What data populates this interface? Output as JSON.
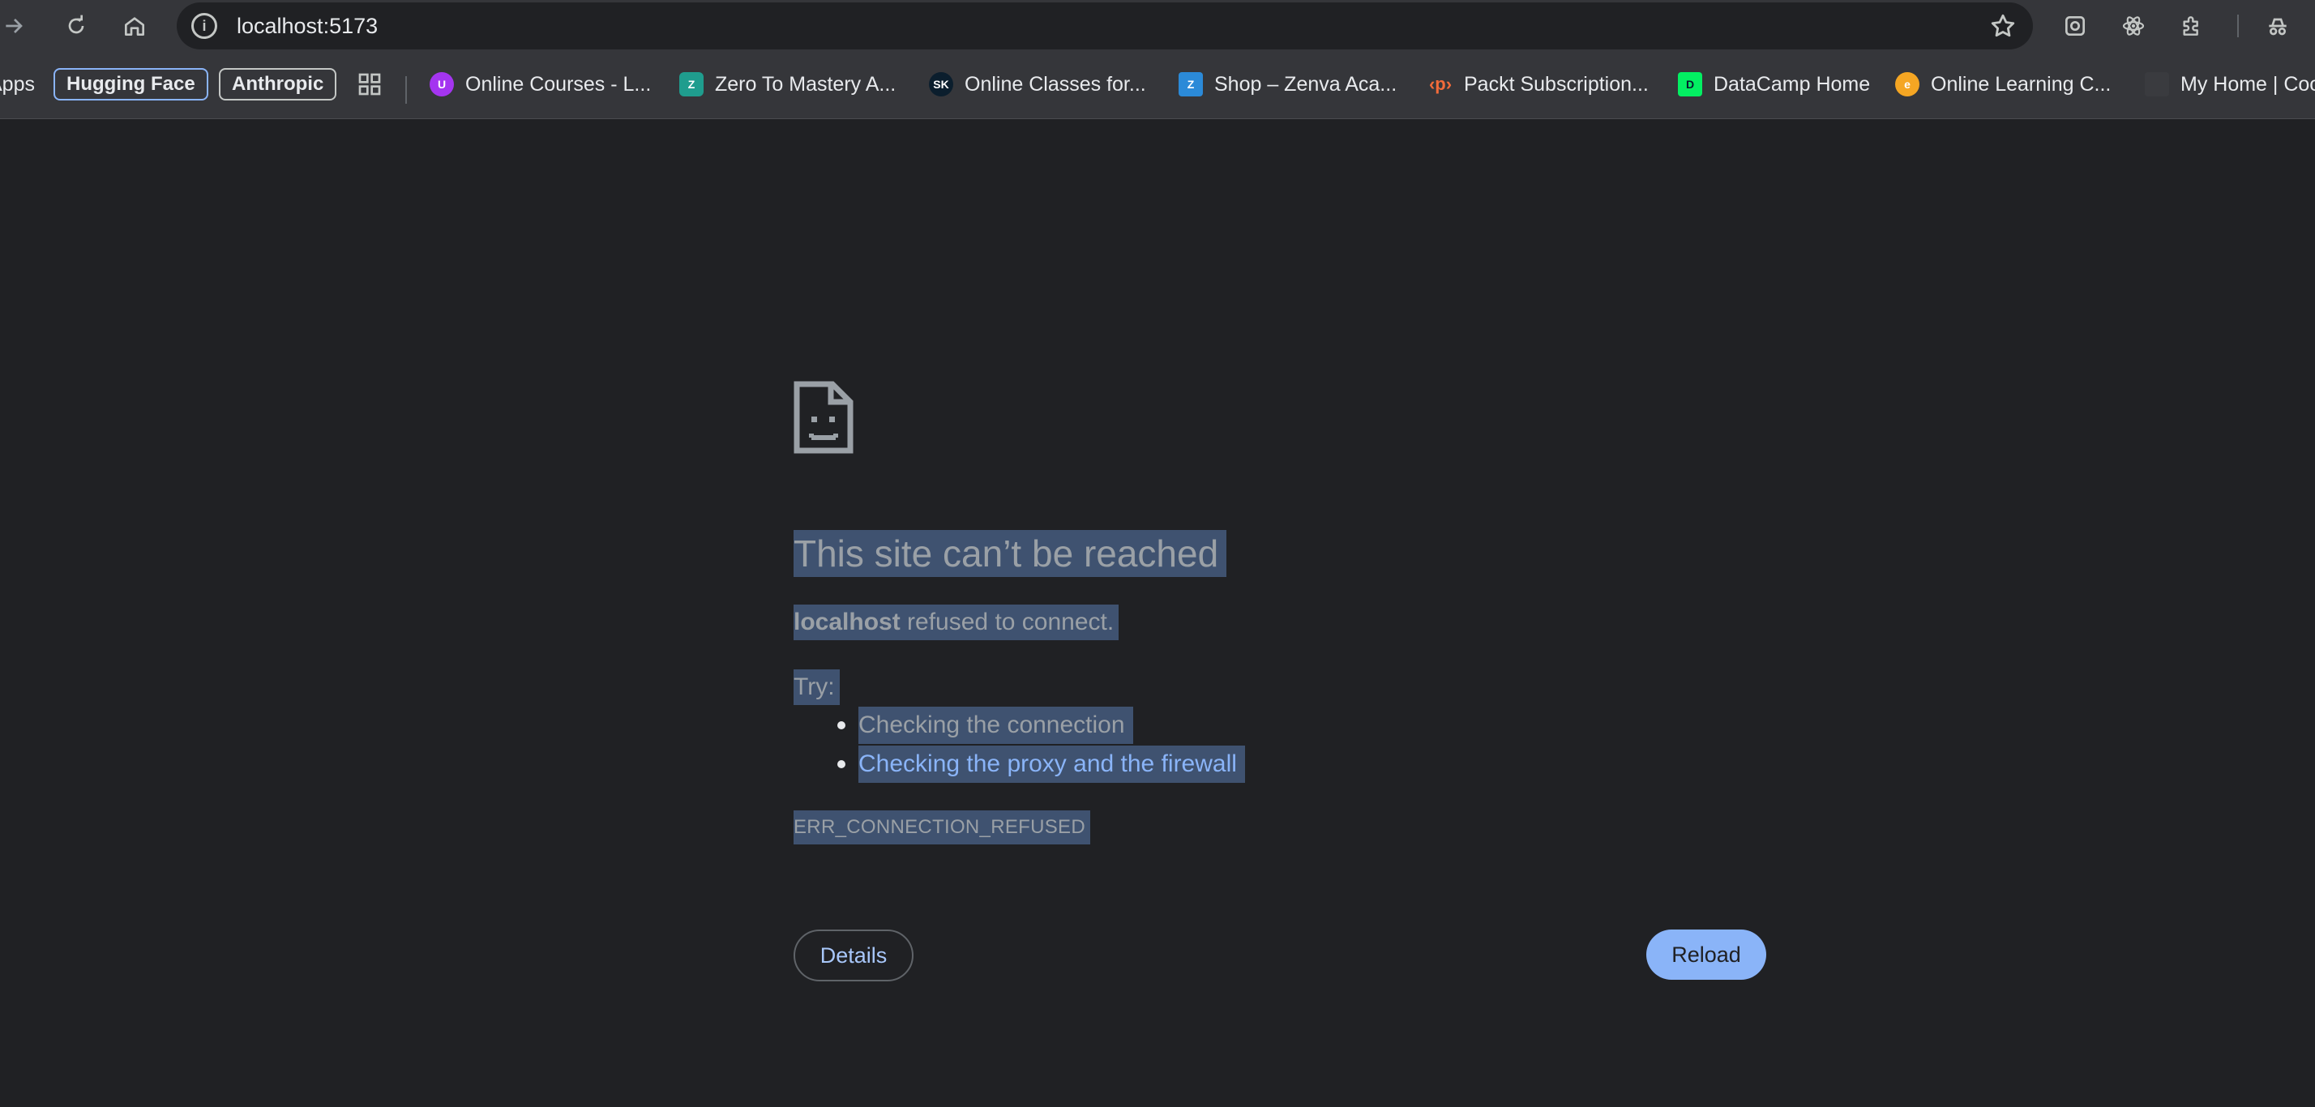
{
  "browser": {
    "url": "localhost:5173",
    "icons": [
      "forward-icon",
      "reload-icon",
      "home-icon",
      "site-info-icon",
      "bookmark-star-icon",
      "screenshot-extension-icon",
      "react-devtools-icon",
      "extensions-icon",
      "incognito-profile-icon"
    ]
  },
  "bookmarks": {
    "apps_label": "Apps",
    "items": [
      {
        "label": "Hugging Face"
      },
      {
        "label": "Anthropic"
      },
      {
        "label": "Online Courses - L..."
      },
      {
        "label": "Zero To Mastery A..."
      },
      {
        "label": "Online Classes for..."
      },
      {
        "label": "Shop – Zenva Aca..."
      },
      {
        "label": "Packt Subscription..."
      },
      {
        "label": "DataCamp Home"
      },
      {
        "label": "Online Learning C..."
      },
      {
        "label": "My Home | Coo"
      }
    ],
    "favicons": [
      "udemy-icon",
      "zero-to-mastery-icon",
      "skillshare-icon",
      "zenva-icon",
      "packt-icon",
      "datacamp-icon",
      "online-learning-icon",
      "codecademy-icon"
    ]
  },
  "error": {
    "title": "This site can’t be reached",
    "host": "localhost",
    "message": "refused to connect.",
    "try_label": "Try:",
    "suggestions": [
      {
        "text": "Checking the connection"
      },
      {
        "text": "Checking the proxy and the firewall"
      }
    ],
    "code": "ERR_CONNECTION_REFUSED",
    "details_button": "Details",
    "reload_button": "Reload"
  },
  "colors": {
    "background": "#202124",
    "toolbar": "#35363a",
    "selection": "#3f5270",
    "link": "#8ab4f8",
    "reload_button": "#8ab4f8"
  }
}
